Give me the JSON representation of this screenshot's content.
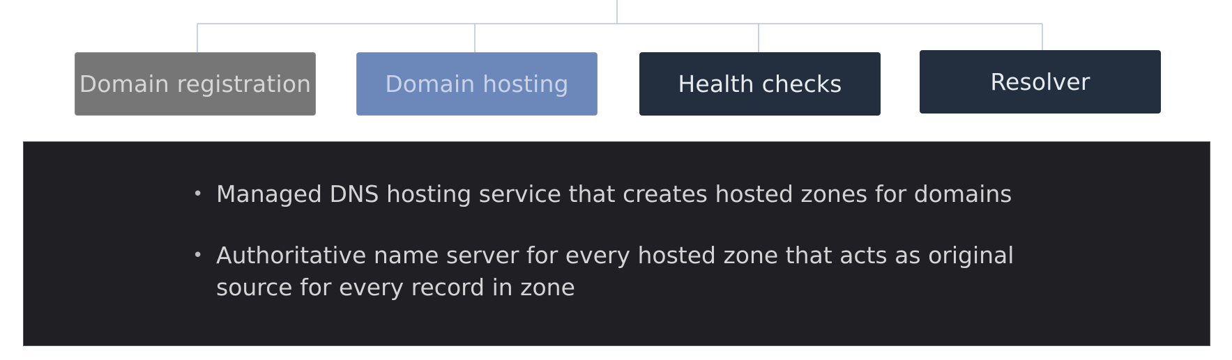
{
  "boxes": [
    {
      "id": "domain-registration",
      "label": "Domain registration"
    },
    {
      "id": "domain-hosting",
      "label": "Domain hosting"
    },
    {
      "id": "health-checks",
      "label": "Health checks"
    },
    {
      "id": "resolver",
      "label": "Resolver"
    }
  ],
  "panel": {
    "bullets": [
      "Managed DNS hosting service that creates hosted zones for domains",
      "Authoritative name server for every hosted zone that acts as original source for every record in zone"
    ]
  },
  "colors": {
    "connector": "#b6c6dc",
    "domain_registration_box": "#767676",
    "domain_hosting_box": "#6c87ba",
    "dark_box": "#232f3e",
    "panel_background": "#1f1f24"
  }
}
